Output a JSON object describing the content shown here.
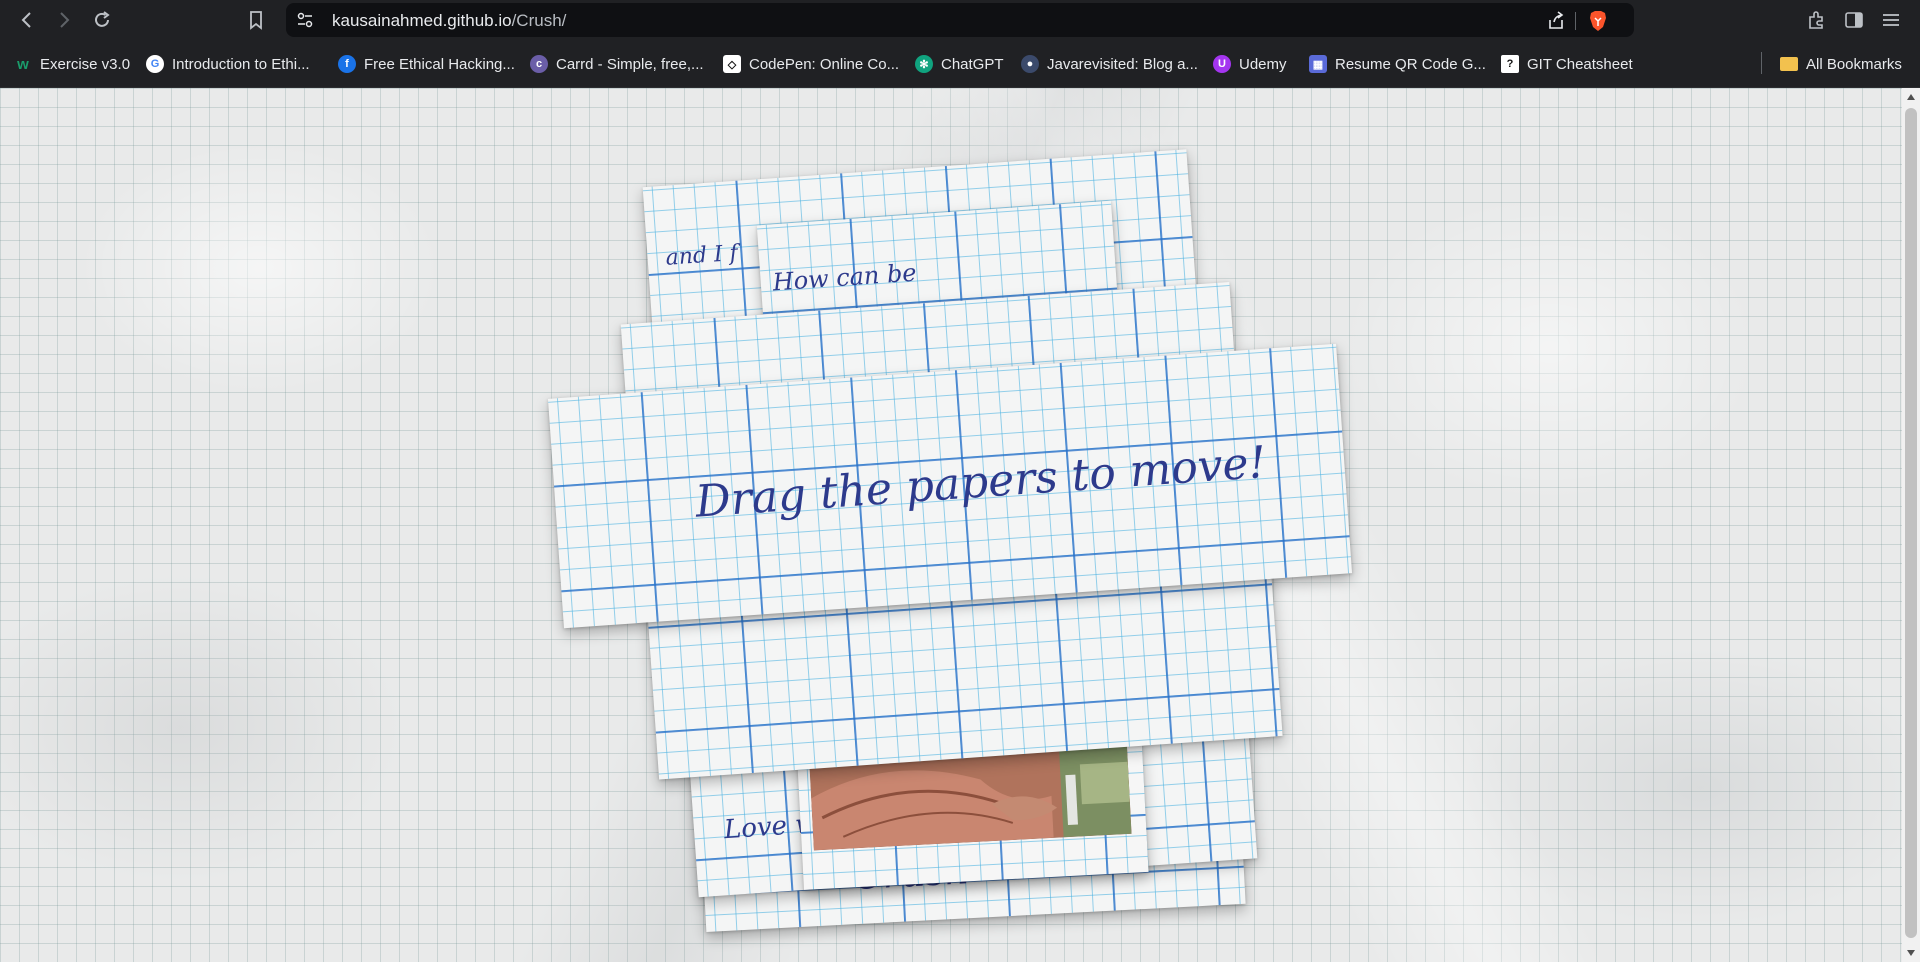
{
  "browser": {
    "url_host": "kausainahmed.github.io",
    "url_path": "/Crush/",
    "bookmarks": [
      {
        "label": "Exercise v3.0",
        "icon": "w-logo-icon",
        "color": "#1a9c6b"
      },
      {
        "label": "Introduction to Ethi...",
        "icon": "google-icon",
        "color": "#ffffff"
      },
      {
        "label": "Free Ethical Hacking...",
        "icon": "globe-icon",
        "color": "#1a73e8"
      },
      {
        "label": "Carrd - Simple, free,...",
        "icon": "carrd-icon",
        "color": "#6b5ea8"
      },
      {
        "label": "CodePen: Online Co...",
        "icon": "codepen-icon",
        "color": "#ffffff"
      },
      {
        "label": "ChatGPT",
        "icon": "chatgpt-icon",
        "color": "#10a37f"
      },
      {
        "label": "Javarevisited: Blog a...",
        "icon": "javarevisited-icon",
        "color": "#3b4a6b"
      },
      {
        "label": "Udemy",
        "icon": "udemy-icon",
        "color": "#a435f0"
      },
      {
        "label": "Resume QR Code G...",
        "icon": "qr-icon",
        "color": "#5a6ad8"
      },
      {
        "label": "GIT Cheatsheet",
        "icon": "question-icon",
        "color": "#ffffff"
      }
    ],
    "all_bookmarks": "All Bookmarks"
  },
  "papers": {
    "top_note_1": "and I f",
    "top_note_2": "How can be",
    "main_text": "Drag the papers to move!",
    "bottom_note": "Love w",
    "crush_text": "Crush"
  },
  "colors": {
    "ink": "#2d3a8c",
    "grid_major": "#286ec8",
    "grid_minor": "#50b4e1",
    "page_bg": "#e9eaea",
    "chrome_bg": "#202124"
  }
}
